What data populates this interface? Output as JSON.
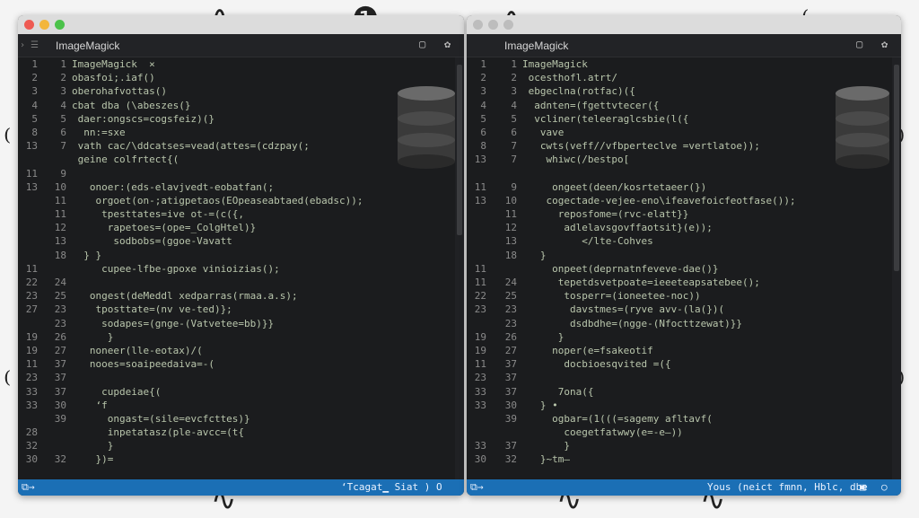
{
  "window_left": {
    "title": "ImageMagick",
    "tab_label": "ImageMagick  ×",
    "chevron": "› ☰",
    "gutter_primary": [
      "1",
      "2",
      "3",
      "4",
      "5",
      "8",
      "13",
      "",
      "11",
      "13",
      "",
      "",
      "",
      "",
      "",
      "11",
      "22",
      "23",
      "27",
      "",
      "19",
      "19",
      "11",
      "23",
      "33",
      "33",
      "",
      "28",
      "32",
      "30"
    ],
    "gutter_secondary": [
      "1",
      "2",
      "3",
      "4",
      "5",
      "6",
      "7",
      "",
      "9",
      "10",
      "11",
      "11",
      "12",
      "13",
      "18",
      "",
      "24",
      "25",
      "23",
      "23",
      "26",
      "27",
      "37",
      "37",
      "37",
      "30",
      "39",
      "",
      "",
      "32"
    ],
    "code_lines": [
      "ImageMagick  ×",
      "obasfoi;.iaf()",
      "oberohafvottas()",
      "cbat dba (\\abeszes(}",
      " daer:ongscs=cogsfeiz)(}",
      "  nn:=sxe",
      " vath cac/\\ddcatses=vead(attes=(cdzpay(;",
      " geine colfrtect{(",
      "",
      "   onoer:(eds-elavjvedt-eobatfan(;",
      "    orgoet(on-;atigpetaos(EOpeaseabtaed(ebadsc));",
      "     tpesttates=ive ot-=(c({,",
      "      rapetoes=(ope=_ColgHtel)}",
      "       sodbobs=(ggoe-Vavatt",
      "  } }",
      "     cupee-lfbe-gpoxe vinioizias();",
      "",
      "   ongest(deMeddl xedparras(rmaa.a.s);",
      "    tposttate=(nv ve-ted)};",
      "     sodapes=(gnge-(Vatvetee=bb)}}",
      "      }",
      "   noneer(lle-eotax)/(",
      "   nooes=soaipeedaiva=-(",
      "",
      "     cupdeiae{(",
      "    ‘f",
      "      ongast=(sile=evcfcttes)}",
      "      inpetatasz(ple-avcc=(t{",
      "      }",
      "    })="
    ],
    "status_left": "⧉→",
    "status_right": "‘Tcagat▁ Siat ) O"
  },
  "window_right": {
    "title": "ImageMagick",
    "gutter_primary": [
      "1",
      "2",
      "3",
      "4",
      "5",
      "6",
      "8",
      "13",
      "",
      "11",
      "13",
      "",
      "",
      "",
      "",
      "11",
      "11",
      "22",
      "23",
      "",
      "19",
      "19",
      "11",
      "23",
      "33",
      "33",
      "",
      "",
      "33",
      "30"
    ],
    "gutter_secondary": [
      "1",
      "2",
      "3",
      "4",
      "5",
      "6",
      "7",
      "7",
      "",
      "9",
      "10",
      "11",
      "12",
      "13",
      "18",
      "",
      "24",
      "25",
      "23",
      "23",
      "26",
      "27",
      "37",
      "37",
      "37",
      "30",
      "39",
      "",
      "37",
      "32"
    ],
    "code_lines": [
      "ImageMagick",
      " ocesthofl.atrt/",
      " ebgeclna(rotfac)({",
      "  adnten=(fgettvtecer({",
      "  vcliner(teleeraglcsbie(l({",
      "   vave",
      "   cwts(veff//vfbperteclve =vertlatoe));",
      "    whiwc(/bestpo[",
      "",
      "     ongeet(deen/kosrtetaeer(})",
      "    cogectade-vejee-eno\\ifeavefoicfeotfase());",
      "      reposfome=(rvc-elatt}}",
      "       adlelavsgovffaotsit}(e));",
      "          </lte-Cohves",
      "   }",
      "     onpeet(deprnatnfeveve-dae()}",
      "      tepetdsvetpoate=ieeeteapsatebee();",
      "       tosperr=(ioneetee-noc))",
      "        davstmes=(ryve avv-(la(})(",
      "        dsdbdhe=(ngge-(Nfocttzewat)}}",
      "      }",
      "     noper(e=fsakeotif",
      "       docbioesqvited =({",
      "",
      "      7ona({",
      "   } •",
      "     ogbar=(1(((=sagemy afltavf(",
      "       coegetfatwwy(e=-e—))",
      "       }",
      "   }~tm—"
    ],
    "status_left": "⧉→",
    "status_right": "Yous (neict fmnn, Hblc, dbe"
  },
  "colors": {
    "statusbar": "#1b6fb5",
    "close": "#ee5a52",
    "minimize": "#f3b63b",
    "zoom": "#4bc24a",
    "editor_bg": "#1b1c1e"
  }
}
